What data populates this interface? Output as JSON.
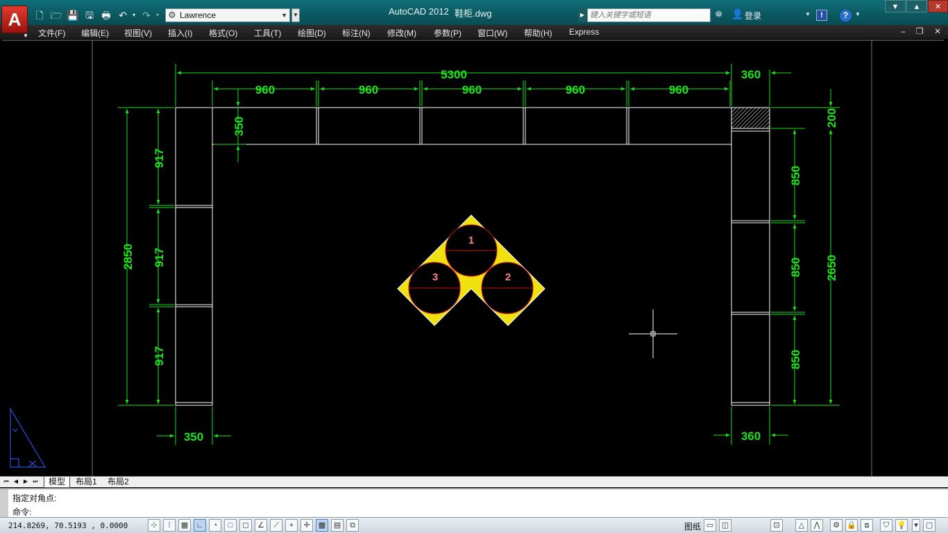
{
  "titlebar": {
    "app_title": "AutoCAD 2012",
    "file_name": "鞋柜.dwg",
    "workspace": "Lawrence",
    "search_placeholder": "键入关键字或短语",
    "login": "登录",
    "logo_letter": "A"
  },
  "menu": {
    "items": [
      "文件(F)",
      "编辑(E)",
      "视图(V)",
      "插入(I)",
      "格式(O)",
      "工具(T)",
      "绘图(D)",
      "标注(N)",
      "修改(M)",
      "参数(P)",
      "窗口(W)",
      "帮助(H)",
      "Express"
    ]
  },
  "drawing": {
    "colors": {
      "dimension": "#19e619",
      "geometry": "#ffffff",
      "circles": "#c81010",
      "hatch": "#f0e010",
      "labels": "#ff8080",
      "crosshair": "#ffffff"
    },
    "dims": {
      "overall_width": "5300",
      "right_cap_width": "360",
      "top_segment_1": "960",
      "top_segment_2": "960",
      "top_segment_3": "960",
      "top_segment_4": "960",
      "top_segment_5": "960",
      "top_depth": "350",
      "left_height": "2850",
      "left_seg_1": "917",
      "left_seg_2": "917",
      "left_seg_3": "917",
      "right_top": "200",
      "right_seg_1": "850",
      "right_seg_2": "850",
      "right_seg_3": "850",
      "right_height": "2650",
      "bottom_left_width": "350",
      "bottom_right_width": "360"
    },
    "circle_labels": [
      "1",
      "2",
      "3"
    ]
  },
  "tabs": {
    "items": [
      "模型",
      "布局1",
      "布局2"
    ],
    "active": "模型"
  },
  "command": {
    "history": "指定对角点:",
    "prompt": "命令:"
  },
  "status": {
    "coordinates": "214.8269, 70.5193 , 0.0000",
    "paper_label": "图纸"
  }
}
